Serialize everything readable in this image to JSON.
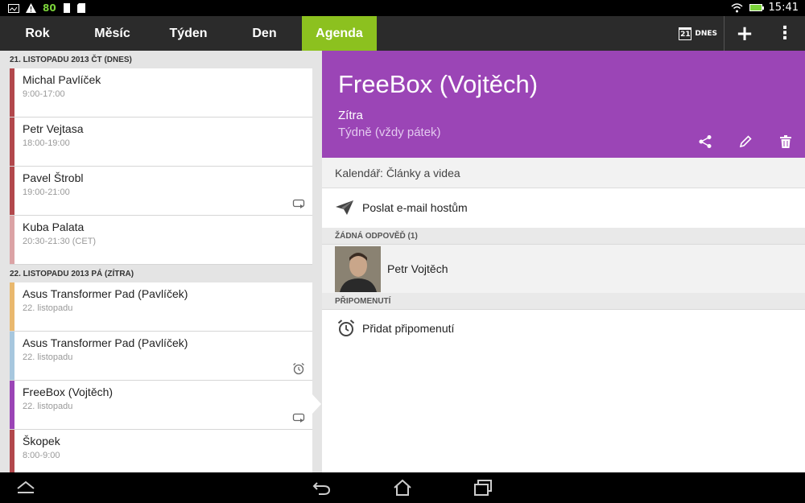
{
  "status": {
    "battery_text": "80",
    "time": "15:41"
  },
  "tabs": [
    {
      "label": "Rok"
    },
    {
      "label": "Měsíc"
    },
    {
      "label": "Týden"
    },
    {
      "label": "Den"
    },
    {
      "label": "Agenda",
      "active": true
    }
  ],
  "actionbar": {
    "today_day": "21",
    "today_label": "DNES",
    "add_label": "+",
    "menu_label": "⋮"
  },
  "agenda": {
    "days": [
      {
        "header": "21. LISTOPADU 2013 ČT (DNES)",
        "events": [
          {
            "title": "Michal Pavlíček",
            "sub": "9:00-17:00",
            "color": "#b2484c",
            "icon": ""
          },
          {
            "title": "Petr Vejtasa",
            "sub": "18:00-19:00",
            "color": "#b2484c",
            "icon": ""
          },
          {
            "title": "Pavel Štrobl",
            "sub": "19:00-21:00",
            "color": "#b2484c",
            "icon": "repeat-icon"
          },
          {
            "title": "Kuba Palata",
            "sub": "20:30-21:30 (CET)",
            "color": "#dba3a5",
            "icon": ""
          }
        ]
      },
      {
        "header": "22. LISTOPADU 2013 PÁ (ZÍTRA)",
        "events": [
          {
            "title": "Asus Transformer Pad (Pavlíček)",
            "sub": "22. listopadu",
            "color": "#e9b86e",
            "icon": ""
          },
          {
            "title": "Asus Transformer Pad (Pavlíček)",
            "sub": "22. listopadu",
            "color": "#a7c7de",
            "icon": "alarm-icon"
          },
          {
            "title": "FreeBox (Vojtěch)",
            "sub": "22. listopadu",
            "color": "#9b45b6",
            "icon": "repeat-icon"
          },
          {
            "title": "Škopek",
            "sub": "8:00-9:00",
            "color": "#b2484c",
            "icon": ""
          }
        ]
      }
    ]
  },
  "detail": {
    "title": "FreeBox (Vojtěch)",
    "when": "Zítra",
    "repeat": "Týdně (vždy pátek)",
    "accent": "#9b45b6",
    "calendar": "Kalendář: Články a videa",
    "email_guests": "Poslat e-mail hostům",
    "no_reply_header": "ŽÁDNÁ ODPOVĚĎ (1)",
    "guest_name": "Petr Vojtěch",
    "reminders_header": "PŘIPOMENUTÍ",
    "add_reminder": "Přidat připomenutí"
  }
}
